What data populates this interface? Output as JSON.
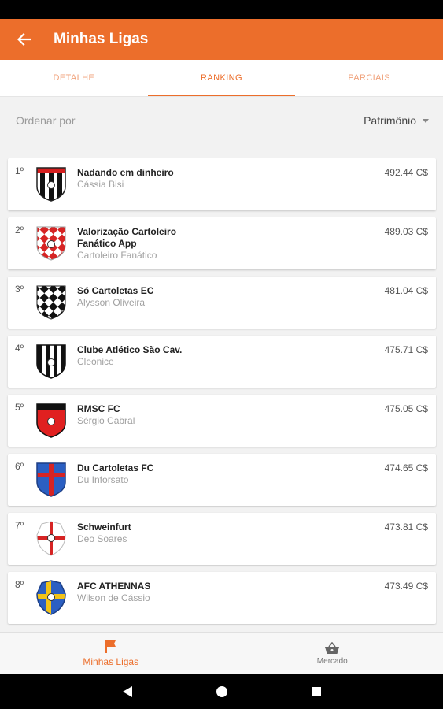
{
  "app_bar": {
    "title": "Minhas Ligas",
    "back_icon": "arrow-left-icon"
  },
  "tabs": [
    {
      "label": "DETALHE",
      "active": false
    },
    {
      "label": "RANKING",
      "active": true
    },
    {
      "label": "PARCIAIS",
      "active": false
    }
  ],
  "sort": {
    "label": "Ordenar por",
    "selected": "Patrimônio"
  },
  "ranking": [
    {
      "rank": "1º",
      "team": "Nadando em dinheiro",
      "owner": "Cássia Bisi",
      "value": "492.44 C$",
      "crest": "black-white-stripes-crest-icon"
    },
    {
      "rank": "2º",
      "team": "Valorização Cartoleiro Fanático App",
      "owner": "Cartoleiro Fanático",
      "value": "489.03 C$",
      "crest": "red-white-checkered-crest-icon"
    },
    {
      "rank": "3º",
      "team": "Só Cartoletas EC",
      "owner": "Alysson Oliveira",
      "value": "481.04 C$",
      "crest": "black-white-checkered-crest-icon"
    },
    {
      "rank": "4º",
      "team": "Clube Atlético São Cav.",
      "owner": "Cleonice",
      "value": "475.71 C$",
      "crest": "black-white-vertical-stripes-crest-icon"
    },
    {
      "rank": "5º",
      "team": "RMSC FC",
      "owner": "Sérgio Cabral",
      "value": "475.05 C$",
      "crest": "red-black-crest-icon"
    },
    {
      "rank": "6º",
      "team": "Du Cartoletas FC",
      "owner": "Du Inforsato",
      "value": "474.65 C$",
      "crest": "blue-red-cross-crest-icon"
    },
    {
      "rank": "7º",
      "team": "Schweinfurt",
      "owner": "Deo Soares",
      "value": "473.81 C$",
      "crest": "white-red-cross-crest-icon"
    },
    {
      "rank": "8º",
      "team": "AFC ATHENNAS",
      "owner": "Wilson de Cássio",
      "value": "473.49 C$",
      "crest": "blue-yellow-cross-crest-icon"
    }
  ],
  "bottom_nav": [
    {
      "label": "Minhas Ligas",
      "icon": "flag-icon",
      "active": true
    },
    {
      "label": "Mercado",
      "icon": "basket-icon",
      "active": false
    }
  ],
  "colors": {
    "accent": "#ec6e2b"
  }
}
